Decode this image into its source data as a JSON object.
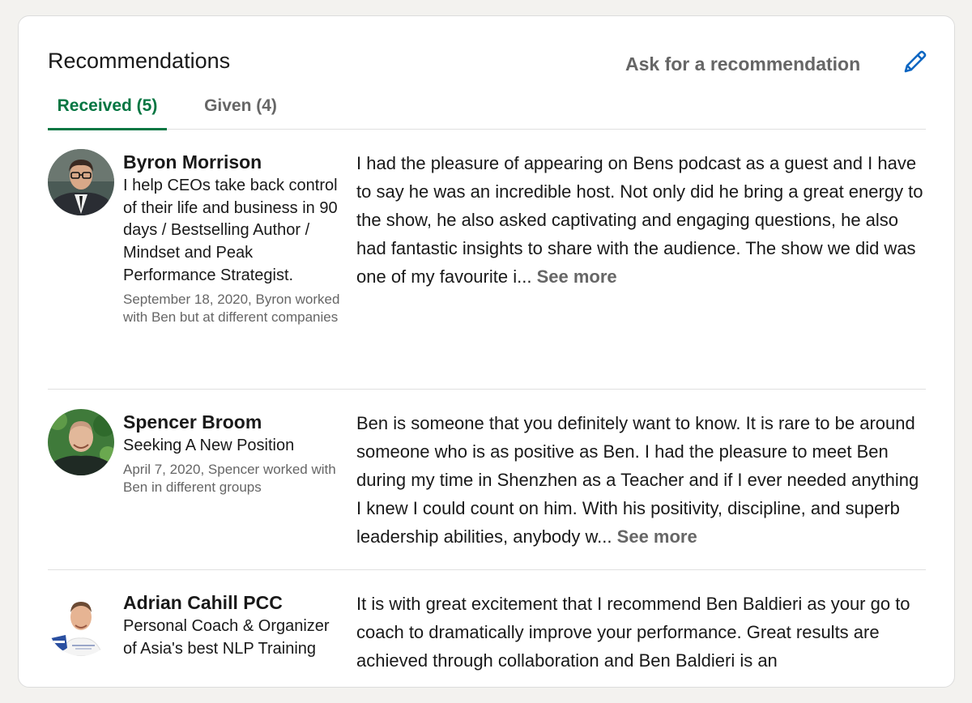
{
  "section": {
    "title": "Recommendations",
    "ask_label": "Ask for a recommendation",
    "edit_icon": "pencil-icon",
    "accent_color": "#057642",
    "link_color": "#0a66c2"
  },
  "tabs": [
    {
      "label": "Received (5)",
      "active": true
    },
    {
      "label": "Given (4)",
      "active": false
    }
  ],
  "recommendations": [
    {
      "name": "Byron Morrison",
      "headline": "I help CEOs take back control of their life and business in 90 days / Bestselling Author / Mindset and Peak Performance Strategist.",
      "relation": "September 18, 2020, Byron worked with Ben but at different companies",
      "text": "I had the pleasure of appearing on Bens podcast as a guest and I have to say he was an incredible host. Not only did he bring a great energy to the show, he also asked captivating and engaging questions, he also had fantastic insights to share with the audience. The show we did was one of my favourite i...",
      "see_more": "See more"
    },
    {
      "name": "Spencer Broom",
      "headline": "Seeking A New Position",
      "relation": "April 7, 2020, Spencer worked with Ben in different groups",
      "text": "Ben is someone that you definitely want to know. It is rare to be around someone who is as positive as Ben. I had the pleasure to meet Ben during my time in Shenzhen as a Teacher and if I ever needed anything I knew I could count on him. With his positivity, discipline, and superb leadership abilities, anybody w...",
      "see_more": "See more"
    },
    {
      "name": "Adrian Cahill PCC",
      "headline": "Personal Coach & Organizer of Asia's best NLP Training",
      "relation": "",
      "text": "It is with great excitement that I recommend Ben Baldieri as your go to coach to dramatically improve your performance. Great results are achieved through collaboration and Ben Baldieri is an",
      "see_more": ""
    }
  ]
}
